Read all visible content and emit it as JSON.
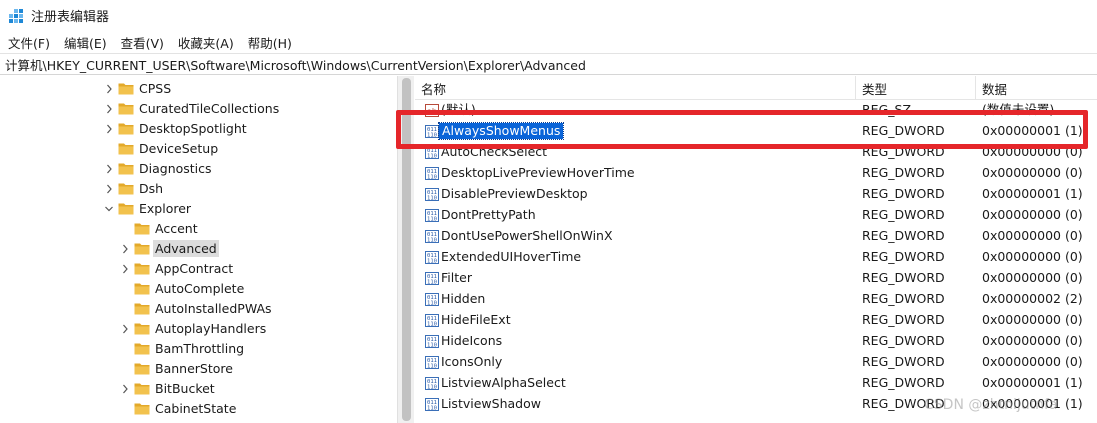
{
  "window": {
    "title": "注册表编辑器"
  },
  "menu": [
    "文件(F)",
    "编辑(E)",
    "查看(V)",
    "收藏夹(A)",
    "帮助(H)"
  ],
  "address": "计算机\\HKEY_CURRENT_USER\\Software\\Microsoft\\Windows\\CurrentVersion\\Explorer\\Advanced",
  "tree": [
    {
      "label": "CPSS",
      "depth": 1,
      "expander": "collapsed"
    },
    {
      "label": "CuratedTileCollections",
      "depth": 1,
      "expander": "collapsed"
    },
    {
      "label": "DesktopSpotlight",
      "depth": 1,
      "expander": "collapsed"
    },
    {
      "label": "DeviceSetup",
      "depth": 1,
      "expander": "none"
    },
    {
      "label": "Diagnostics",
      "depth": 1,
      "expander": "collapsed"
    },
    {
      "label": "Dsh",
      "depth": 1,
      "expander": "collapsed"
    },
    {
      "label": "Explorer",
      "depth": 1,
      "expander": "expanded"
    },
    {
      "label": "Accent",
      "depth": 2,
      "expander": "none"
    },
    {
      "label": "Advanced",
      "depth": 2,
      "expander": "collapsed",
      "selected": true
    },
    {
      "label": "AppContract",
      "depth": 2,
      "expander": "collapsed"
    },
    {
      "label": "AutoComplete",
      "depth": 2,
      "expander": "none"
    },
    {
      "label": "AutoInstalledPWAs",
      "depth": 2,
      "expander": "none"
    },
    {
      "label": "AutoplayHandlers",
      "depth": 2,
      "expander": "collapsed"
    },
    {
      "label": "BamThrottling",
      "depth": 2,
      "expander": "none"
    },
    {
      "label": "BannerStore",
      "depth": 2,
      "expander": "none"
    },
    {
      "label": "BitBucket",
      "depth": 2,
      "expander": "collapsed"
    },
    {
      "label": "CabinetState",
      "depth": 2,
      "expander": "none"
    }
  ],
  "columns": {
    "name": "名称",
    "type": "类型",
    "data": "数据"
  },
  "values": [
    {
      "name": "(默认)",
      "type": "REG_SZ",
      "data": "(数值未设置)",
      "icon": "string-value-icon"
    },
    {
      "name": "AlwaysShowMenus",
      "type": "REG_DWORD",
      "data": "0x00000001 (1)",
      "icon": "dword-value-icon",
      "selected": true
    },
    {
      "name": "AutoCheckSelect",
      "type": "REG_DWORD",
      "data": "0x00000000 (0)",
      "icon": "dword-value-icon"
    },
    {
      "name": "DesktopLivePreviewHoverTime",
      "type": "REG_DWORD",
      "data": "0x00000000 (0)",
      "icon": "dword-value-icon"
    },
    {
      "name": "DisablePreviewDesktop",
      "type": "REG_DWORD",
      "data": "0x00000001 (1)",
      "icon": "dword-value-icon"
    },
    {
      "name": "DontPrettyPath",
      "type": "REG_DWORD",
      "data": "0x00000000 (0)",
      "icon": "dword-value-icon"
    },
    {
      "name": "DontUsePowerShellOnWinX",
      "type": "REG_DWORD",
      "data": "0x00000000 (0)",
      "icon": "dword-value-icon"
    },
    {
      "name": "ExtendedUIHoverTime",
      "type": "REG_DWORD",
      "data": "0x00000000 (0)",
      "icon": "dword-value-icon"
    },
    {
      "name": "Filter",
      "type": "REG_DWORD",
      "data": "0x00000000 (0)",
      "icon": "dword-value-icon"
    },
    {
      "name": "Hidden",
      "type": "REG_DWORD",
      "data": "0x00000002 (2)",
      "icon": "dword-value-icon"
    },
    {
      "name": "HideFileExt",
      "type": "REG_DWORD",
      "data": "0x00000000 (0)",
      "icon": "dword-value-icon"
    },
    {
      "name": "HideIcons",
      "type": "REG_DWORD",
      "data": "0x00000000 (0)",
      "icon": "dword-value-icon"
    },
    {
      "name": "IconsOnly",
      "type": "REG_DWORD",
      "data": "0x00000000 (0)",
      "icon": "dword-value-icon"
    },
    {
      "name": "ListviewAlphaSelect",
      "type": "REG_DWORD",
      "data": "0x00000001 (1)",
      "icon": "dword-value-icon"
    },
    {
      "name": "ListviewShadow",
      "type": "REG_DWORD",
      "data": "0x00000001 (1)",
      "icon": "dword-value-icon"
    }
  ],
  "watermark": "CSDN @zhtnijutnfa",
  "colors": {
    "selection": "#0a64d8",
    "highlight_box": "#e5262a",
    "folder": "#f2c24d"
  }
}
